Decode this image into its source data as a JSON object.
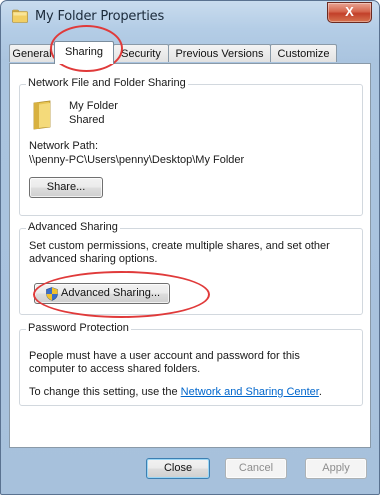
{
  "window": {
    "title": "My Folder Properties",
    "close_symbol": "X"
  },
  "tabs": [
    {
      "label": "General"
    },
    {
      "label": "Sharing"
    },
    {
      "label": "Security"
    },
    {
      "label": "Previous Versions"
    },
    {
      "label": "Customize"
    }
  ],
  "network_sharing": {
    "heading": "Network File and Folder Sharing",
    "folder_name": "My Folder",
    "folder_status": "Shared",
    "path_label": "Network Path:",
    "path_value": "\\\\penny-PC\\Users\\penny\\Desktop\\My Folder",
    "share_button": "Share..."
  },
  "advanced_sharing": {
    "heading": "Advanced Sharing",
    "description_line1": "Set custom permissions, create multiple shares, and set other",
    "description_line2": "advanced sharing options.",
    "button": "Advanced Sharing..."
  },
  "password_protection": {
    "heading": "Password Protection",
    "line1": "People must have a user account and password for this",
    "line2": "computer to access shared folders.",
    "change_prefix": "To change this setting, use the",
    "link": "Network and Sharing Center",
    "change_suffix": "."
  },
  "footer": {
    "close": "Close",
    "cancel": "Cancel",
    "apply": "Apply"
  },
  "colors": {
    "annotation": "#e03a3a",
    "link": "#0066cc"
  }
}
